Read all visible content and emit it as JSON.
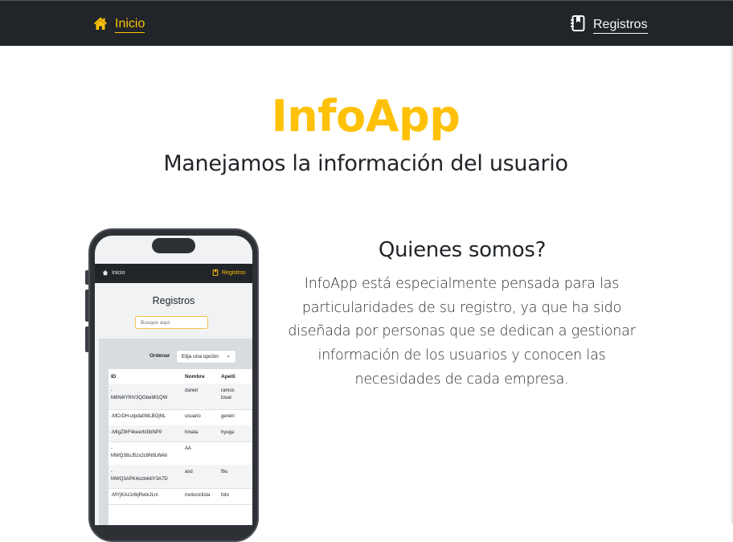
{
  "navbar": {
    "home_label": "Inicio",
    "records_label": "Registros",
    "home_icon": "house-icon",
    "records_icon": "journal-bookmark-icon"
  },
  "hero": {
    "title": "InfoApp",
    "subtitle": "Manejamos la información del usuario"
  },
  "about": {
    "heading": "Quienes somos?",
    "lines": [
      "InfoApp está especialmente pensada para las",
      "particularidades de su registro, ya que ha sido",
      "diseñada por personas que se dedican a gestionar",
      "información de los usuarios y conocen las",
      "necesidades de cada empresa."
    ]
  },
  "mockup": {
    "nav_home": "Inicio",
    "nav_records": "Registros",
    "title": "Registros",
    "search_placeholder": "Busque aqui",
    "order_label": "Ordenar",
    "order_select": "Elija una opción",
    "table": {
      "headers": [
        "ID",
        "Nombre",
        "Apelli"
      ],
      "rows": [
        {
          "id": "-\nM8N4lYRiV3QGbeMl1QW",
          "name": "daniel",
          "last": "ramos\ntovar"
        },
        {
          "id": "-MCrDH-utpda0MLBOjNL",
          "name": "usuario",
          "last": "genéri"
        },
        {
          "id": "-MIgZ9rF4keerb3IbNP9",
          "name": "hinata",
          "last": "hyuga"
        },
        {
          "id": "-\nMWQ38sJ5zx2c8N8LWAh",
          "name": "AA",
          "last": ""
        },
        {
          "id": "-\nMWQ3APK4ozb4dlY3A7D",
          "name": "asd",
          "last": "fbu"
        },
        {
          "id": "-MYjKAz1r6ijRwlxJLni",
          "name": "motociclista",
          "last": "foto"
        }
      ]
    }
  },
  "colors": {
    "accent": "#ffc107",
    "navbar": "#212529"
  }
}
